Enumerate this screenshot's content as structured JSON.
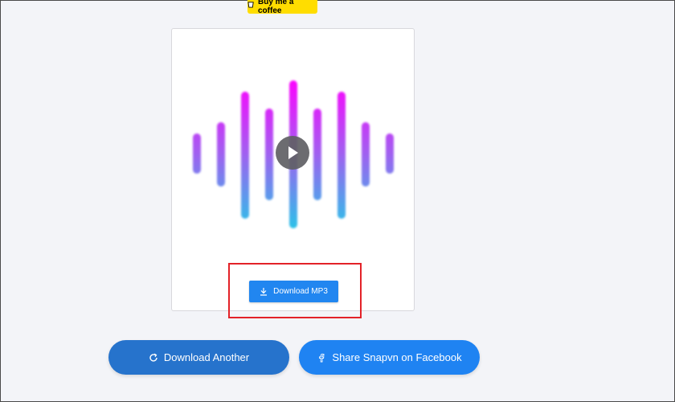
{
  "coffee_button": {
    "label": "Buy me a coffee",
    "color": "#ffdd00"
  },
  "player": {
    "play_icon": "play-icon",
    "waveform_colors": [
      "#ff00ff",
      "#29c4e8"
    ]
  },
  "download_mp3": {
    "label": "Download MP3",
    "icon": "download-icon",
    "color": "#2186f0"
  },
  "actions": {
    "download_another": {
      "label": "Download Another",
      "icon": "refresh-icon",
      "color": "#2673cc"
    },
    "share_facebook": {
      "label": "Share Snapvn on Facebook",
      "icon": "facebook-icon",
      "color": "#1f83f2"
    }
  },
  "annotation": {
    "highlight_color": "#e32228"
  }
}
